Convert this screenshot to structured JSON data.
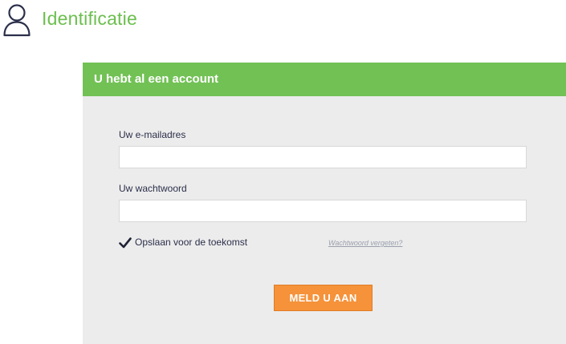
{
  "header": {
    "icon": "user-icon",
    "title": "Identificatie"
  },
  "panel": {
    "title": "U hebt al een account",
    "email": {
      "label": "Uw e-mailadres",
      "value": "",
      "placeholder": ""
    },
    "password": {
      "label": "Uw wachtwoord",
      "value": "",
      "placeholder": ""
    },
    "remember": {
      "label": "Opslaan voor de toekomst",
      "checked": true,
      "icon": "checkmark-icon"
    },
    "forgot_link": "Wachtwoord vergeten?",
    "submit_label": "MELD U AAN"
  },
  "colors": {
    "accent_green": "#72c155",
    "title_green": "#6cbf4f",
    "button_orange": "#f5923a",
    "panel_bg": "#ececec",
    "icon_navy": "#2b2f4a"
  }
}
